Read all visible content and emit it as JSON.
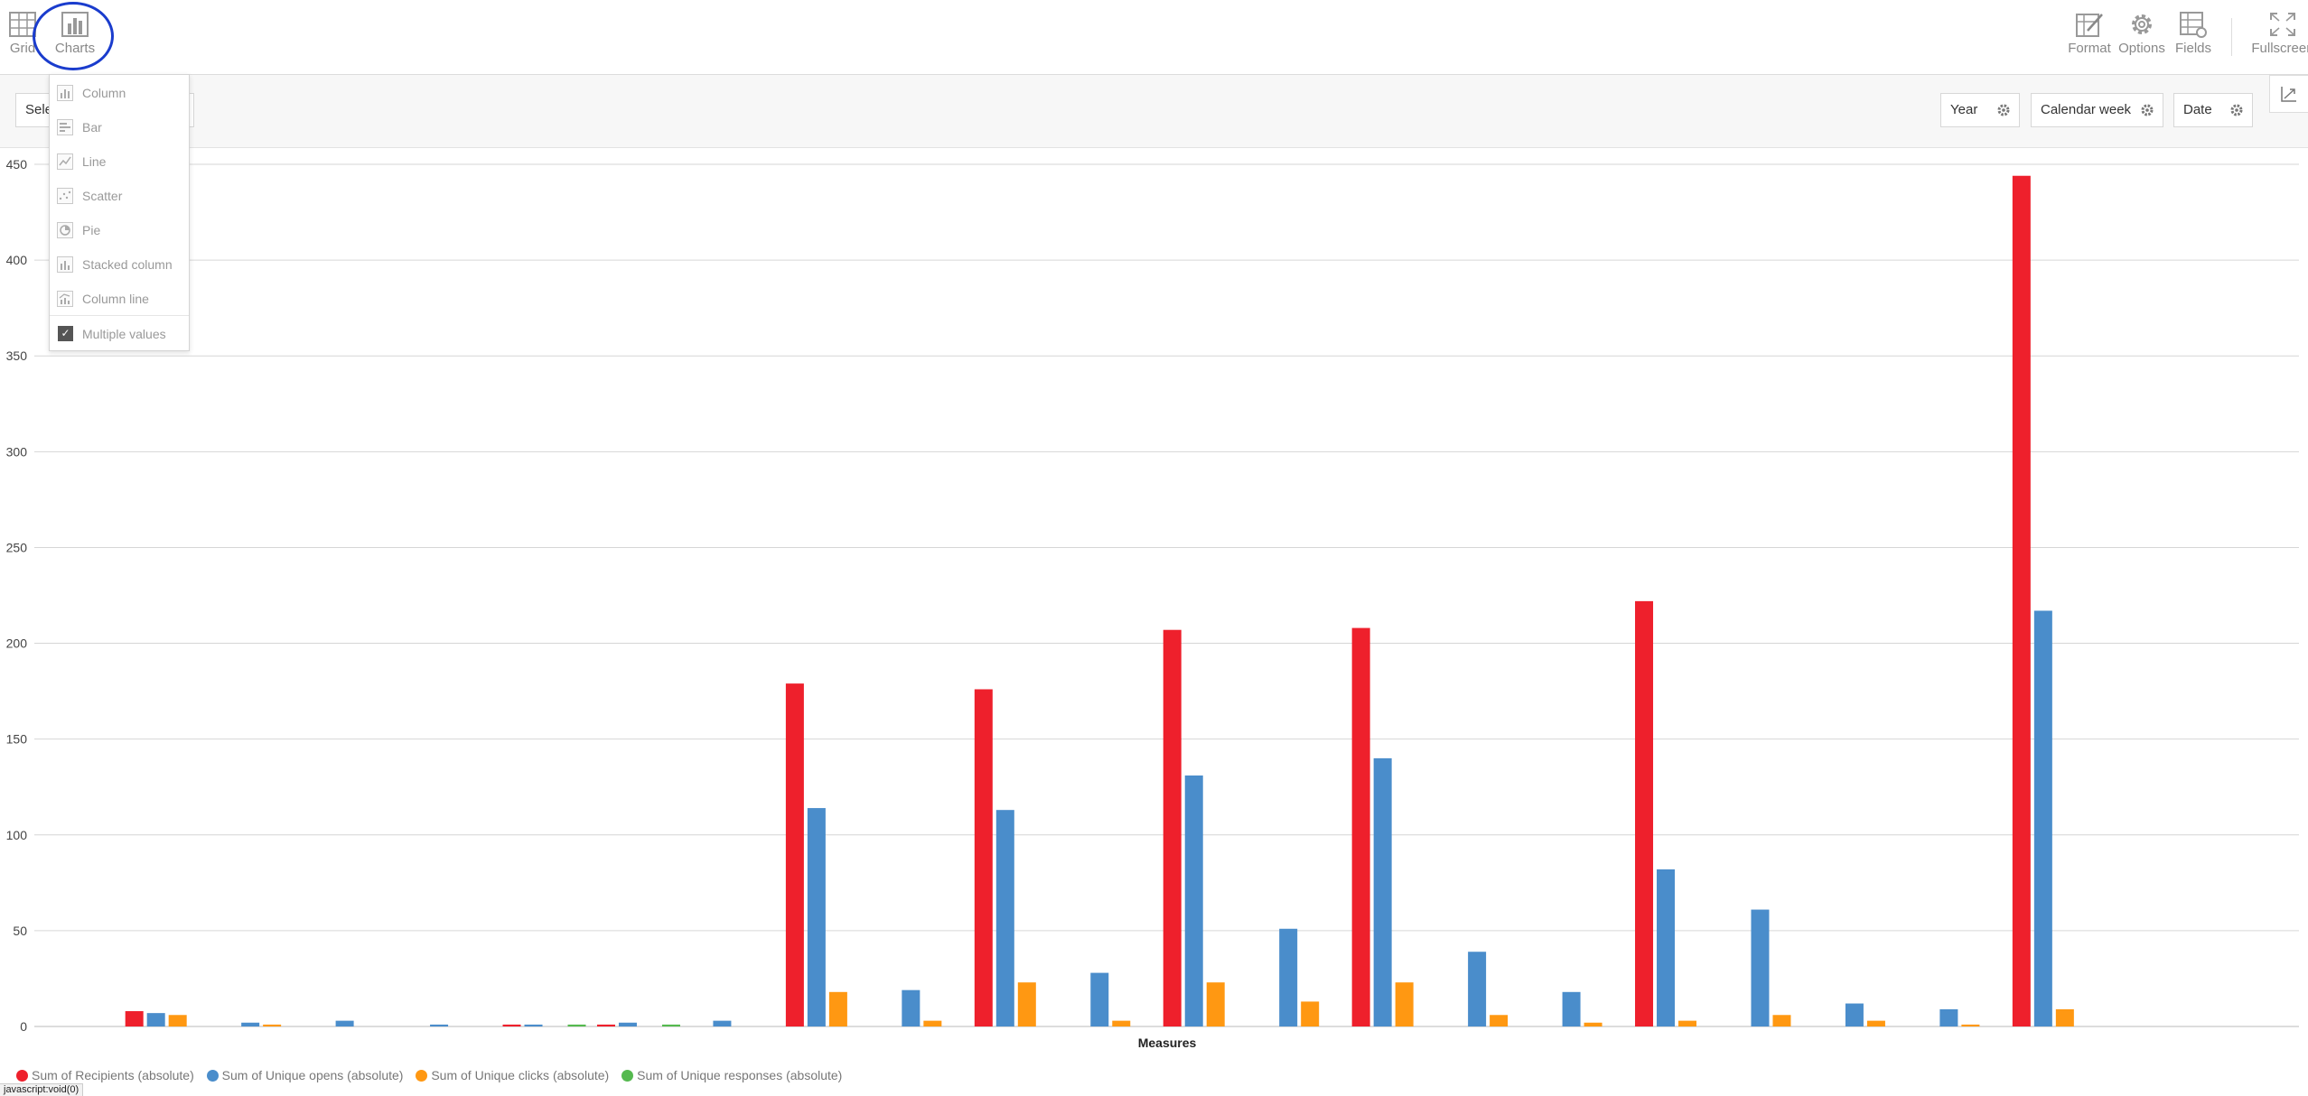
{
  "toolbar": {
    "grid_label": "Grid",
    "charts_label": "Charts",
    "format_label": "Format",
    "options_label": "Options",
    "fields_label": "Fields",
    "fullscreen_label": "Fullscreen"
  },
  "filters": {
    "select_value": "Sele",
    "chips": [
      "Year",
      "Calendar week",
      "Date"
    ]
  },
  "chart_menu": {
    "items": [
      "Column",
      "Bar",
      "Line",
      "Scatter",
      "Pie",
      "Stacked column",
      "Column line"
    ],
    "multiple_values": "Multiple values",
    "multiple_checked": true
  },
  "chart_data": {
    "type": "bar",
    "xlabel": "Measures",
    "ylabel": "",
    "ylim": [
      0,
      450
    ],
    "yticks": [
      0,
      50,
      100,
      150,
      200,
      250,
      300,
      350,
      400,
      450
    ],
    "grid": true,
    "legend_position": "bottom-left",
    "groups": 24,
    "series": [
      {
        "name": "Sum of Recipients (absolute)",
        "color": "#ee202c",
        "values": [
          0,
          8,
          0,
          0,
          0,
          1,
          1,
          0,
          179,
          0,
          176,
          0,
          207,
          0,
          208,
          0,
          0,
          222,
          0,
          0,
          0,
          444,
          0,
          0
        ]
      },
      {
        "name": "Sum of Unique opens (absolute)",
        "color": "#4a8dcb",
        "values": [
          0,
          7,
          2,
          3,
          1,
          1,
          2,
          3,
          114,
          19,
          113,
          28,
          131,
          51,
          140,
          39,
          18,
          82,
          61,
          12,
          9,
          217,
          0,
          0
        ]
      },
      {
        "name": "Sum of Unique clicks (absolute)",
        "color": "#ff9812",
        "values": [
          0,
          6,
          1,
          0,
          0,
          0,
          0,
          0,
          18,
          3,
          23,
          3,
          23,
          13,
          23,
          6,
          2,
          3,
          6,
          3,
          1,
          9,
          0,
          0
        ]
      },
      {
        "name": "Sum of Unique responses (absolute)",
        "color": "#55b94f",
        "values": [
          0,
          0,
          0,
          0,
          0,
          1,
          1,
          0,
          0,
          0,
          0,
          0,
          0,
          0,
          0,
          0,
          0,
          0,
          0,
          0,
          0,
          0,
          0,
          0
        ]
      }
    ]
  },
  "status": {
    "text": "javascript:void(0)"
  }
}
